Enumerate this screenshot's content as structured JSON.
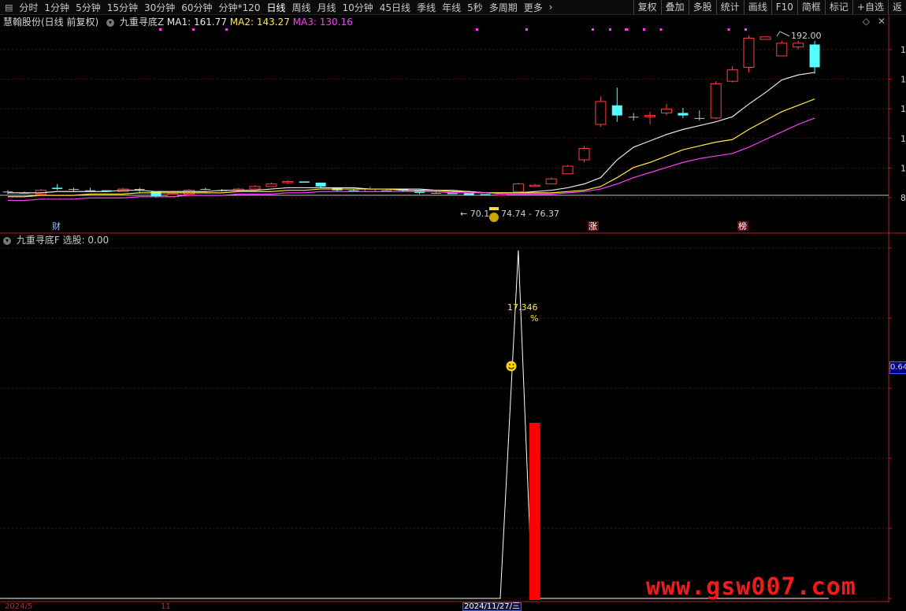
{
  "toolbar": {
    "periods": [
      "分时",
      "1分钟",
      "5分钟",
      "15分钟",
      "30分钟",
      "60分钟",
      "分钟*120",
      "日线",
      "周线",
      "月线",
      "10分钟",
      "45日线",
      "季线",
      "年线",
      "5秒",
      "多周期",
      "更多"
    ],
    "more_arrow": "›",
    "active_period": "日线",
    "right_buttons": [
      "复权",
      "叠加",
      "多股",
      "统计",
      "画线",
      "F10",
      "简框",
      "标记",
      "+自选",
      "返"
    ]
  },
  "main_info": {
    "stock_label": "慧翰股份(日线 前复权)",
    "indicator_name": "九重寻底Z",
    "ma1_label": "MA1: 161.77",
    "ma2_label": "MA2: 143.27",
    "ma3_label": "MA3: 130.16",
    "colors": {
      "ma1": "#e8e8e8",
      "ma2": "#ffeb3b",
      "ma3": "#ff3cff",
      "up": "#ff4040",
      "down": "#54ffff",
      "flat": "#c0c0c0"
    }
  },
  "top_icons": [
    "◇",
    "✕"
  ],
  "annotations": {
    "high": "192.00",
    "low_range": "← 70.1",
    "low_range_2": "74.74 - 76.37",
    "marker_cai": "财",
    "marker_zhang": "涨",
    "marker_bang": "榜"
  },
  "sub_info": {
    "indicator_name": "九重寻底F",
    "value_label": "选股: 0.00"
  },
  "sub_chart": {
    "percent_value": "17.346",
    "percent_unit": "%",
    "smiley": "☺",
    "right_tag": "0.64"
  },
  "price_axis_labels": [
    "1",
    "1",
    "1",
    "1",
    "1",
    "8"
  ],
  "dates": {
    "start": "2024/5",
    "mid": "11",
    "selected": "2024/11/27/三"
  },
  "watermark": "www.gsw007.com",
  "chart_data": {
    "type": "candlestick",
    "title": "慧翰股份(日线 前复权)",
    "x": [
      1,
      2,
      3,
      4,
      5,
      6,
      7,
      8,
      9,
      10,
      11,
      12,
      13,
      14,
      15,
      16,
      17,
      18,
      19,
      20,
      21,
      22,
      23,
      24,
      25,
      26,
      27,
      28,
      29,
      30,
      31,
      32,
      33,
      34,
      35,
      36,
      37,
      38,
      39,
      40,
      41,
      42,
      43,
      44,
      45,
      46,
      47,
      48,
      49,
      50
    ],
    "ohlc": [
      [
        73,
        74,
        71,
        73
      ],
      [
        72,
        73,
        72,
        72
      ],
      [
        71,
        75,
        71,
        74
      ],
      [
        76,
        79,
        74,
        75
      ],
      [
        75,
        76,
        73,
        75
      ],
      [
        74,
        76,
        73,
        74
      ],
      [
        74,
        74,
        73,
        73
      ],
      [
        73,
        76,
        73,
        75
      ],
      [
        75,
        76,
        72,
        75
      ],
      [
        73,
        73,
        68,
        69
      ],
      [
        69,
        72,
        69,
        71
      ],
      [
        71,
        75,
        71,
        74
      ],
      [
        75,
        76,
        74,
        75
      ],
      [
        74,
        75,
        73,
        74
      ],
      [
        74,
        76,
        74,
        75
      ],
      [
        75,
        78,
        75,
        77
      ],
      [
        77,
        80,
        77,
        79
      ],
      [
        80,
        82,
        79,
        81
      ],
      [
        81,
        81,
        80,
        80
      ],
      [
        80,
        80,
        76,
        77
      ],
      [
        76,
        76,
        73,
        74
      ],
      [
        74,
        75,
        73,
        73
      ],
      [
        73,
        77,
        73,
        75
      ],
      [
        74,
        75,
        74,
        74
      ],
      [
        75,
        75,
        73,
        74
      ],
      [
        74,
        74,
        71,
        72
      ],
      [
        72,
        73,
        72,
        72
      ],
      [
        72,
        73,
        71,
        71
      ],
      [
        72,
        72,
        70,
        70
      ],
      [
        71,
        71,
        70,
        70
      ],
      [
        70,
        72,
        70,
        71
      ],
      [
        73,
        80,
        73,
        79
      ],
      [
        77,
        79,
        77,
        78
      ],
      [
        79,
        84,
        79,
        83
      ],
      [
        87,
        94,
        87,
        93
      ],
      [
        98,
        109,
        96,
        107
      ],
      [
        126,
        148,
        124,
        144
      ],
      [
        141,
        155,
        128,
        133
      ],
      [
        132,
        135,
        129,
        132
      ],
      [
        132,
        136,
        126,
        133
      ],
      [
        135,
        142,
        133,
        138
      ],
      [
        135,
        139,
        131,
        133
      ],
      [
        131,
        137,
        129,
        131
      ],
      [
        131,
        160,
        130,
        158
      ],
      [
        160,
        172,
        159,
        169
      ],
      [
        171,
        196,
        167,
        194
      ],
      [
        193,
        198,
        198,
        195
      ],
      [
        180,
        192,
        185,
        190
      ],
      [
        187,
        192,
        185,
        190
      ],
      [
        189,
        192,
        166,
        171
      ]
    ],
    "ma1": [
      72,
      72,
      72,
      73,
      73,
      73,
      73,
      74,
      74,
      73,
      73,
      73,
      73,
      74,
      74,
      74,
      75,
      76,
      76,
      76,
      76,
      76,
      75,
      75,
      75,
      75,
      74,
      74,
      73,
      72,
      72,
      72,
      73,
      74,
      76,
      79,
      84,
      98,
      108,
      113,
      118,
      122,
      125,
      128,
      132,
      142,
      151,
      161,
      165,
      167
    ],
    "ma2": [
      69,
      69,
      70,
      70,
      70,
      71,
      71,
      71,
      72,
      72,
      72,
      72,
      72,
      72,
      73,
      73,
      73,
      74,
      74,
      75,
      75,
      75,
      75,
      75,
      74,
      74,
      74,
      73,
      73,
      72,
      72,
      72,
      72,
      72,
      73,
      74,
      77,
      84,
      92,
      96,
      101,
      106,
      109,
      112,
      114,
      122,
      129,
      136,
      141,
      146
    ],
    "ma3": [
      66,
      66,
      67,
      67,
      67,
      68,
      68,
      68,
      69,
      69,
      69,
      70,
      70,
      70,
      71,
      71,
      71,
      72,
      72,
      73,
      73,
      73,
      73,
      73,
      73,
      73,
      73,
      72,
      72,
      72,
      71,
      71,
      71,
      71,
      72,
      73,
      75,
      79,
      84,
      88,
      92,
      96,
      99,
      101,
      103,
      108,
      114,
      120,
      126,
      131
    ],
    "high_label": 192.0,
    "low_label": 70.1,
    "sub_series": {
      "name": "九重寻底F",
      "line_peak_index": 31,
      "bar_index": 32,
      "bar_value": 17.346
    }
  }
}
